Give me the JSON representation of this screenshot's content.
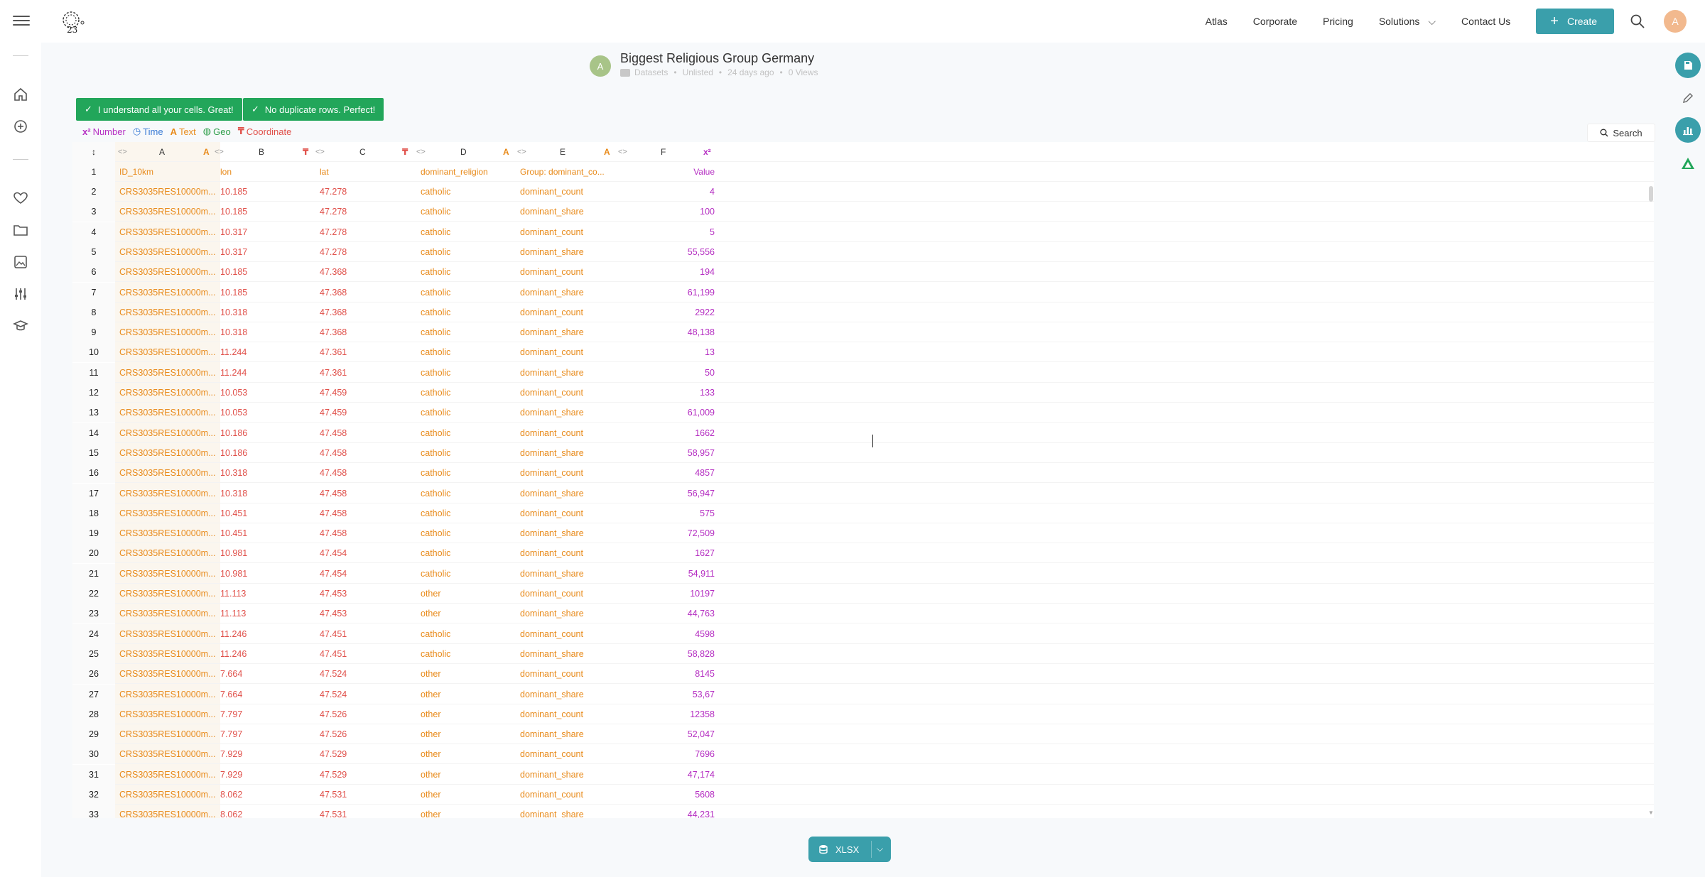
{
  "nav": {
    "links": [
      "Atlas",
      "Corporate",
      "Pricing",
      "Solutions",
      "Contact Us"
    ],
    "create_label": "Create",
    "avatar_initial": "A"
  },
  "dataset": {
    "title": "Biggest Religious Group Germany",
    "avatar_initial": "A",
    "folder": "Datasets",
    "visibility": "Unlisted",
    "age": "24 days ago",
    "views": "0 Views"
  },
  "badges": [
    "I understand all your cells. Great!",
    "No duplicate rows. Perfect!"
  ],
  "legend": {
    "number": "Number",
    "time": "Time",
    "text": "Text",
    "geo": "Geo",
    "coordinate": "Coordinate",
    "number_sym": "x²",
    "text_sym": "A",
    "coord_sym": "₸"
  },
  "search_label": "Search",
  "table": {
    "corner": "↕",
    "letters": [
      "A",
      "B",
      "C",
      "D",
      "E",
      "F"
    ],
    "headers": [
      "ID_10km",
      "lon",
      "lat",
      "dominant_religion",
      "Group: dominant_co...",
      "Value"
    ],
    "rows": [
      [
        "2",
        "CRS3035RES10000m...",
        "10.185",
        "47.278",
        "catholic",
        "dominant_count",
        "4"
      ],
      [
        "3",
        "CRS3035RES10000m...",
        "10.185",
        "47.278",
        "catholic",
        "dominant_share",
        "100"
      ],
      [
        "4",
        "CRS3035RES10000m...",
        "10.317",
        "47.278",
        "catholic",
        "dominant_count",
        "5"
      ],
      [
        "5",
        "CRS3035RES10000m...",
        "10.317",
        "47.278",
        "catholic",
        "dominant_share",
        "55,556"
      ],
      [
        "6",
        "CRS3035RES10000m...",
        "10.185",
        "47.368",
        "catholic",
        "dominant_count",
        "194"
      ],
      [
        "7",
        "CRS3035RES10000m...",
        "10.185",
        "47.368",
        "catholic",
        "dominant_share",
        "61,199"
      ],
      [
        "8",
        "CRS3035RES10000m...",
        "10.318",
        "47.368",
        "catholic",
        "dominant_count",
        "2922"
      ],
      [
        "9",
        "CRS3035RES10000m...",
        "10.318",
        "47.368",
        "catholic",
        "dominant_share",
        "48,138"
      ],
      [
        "10",
        "CRS3035RES10000m...",
        "11.244",
        "47.361",
        "catholic",
        "dominant_count",
        "13"
      ],
      [
        "11",
        "CRS3035RES10000m...",
        "11.244",
        "47.361",
        "catholic",
        "dominant_share",
        "50"
      ],
      [
        "12",
        "CRS3035RES10000m...",
        "10.053",
        "47.459",
        "catholic",
        "dominant_count",
        "133"
      ],
      [
        "13",
        "CRS3035RES10000m...",
        "10.053",
        "47.459",
        "catholic",
        "dominant_share",
        "61,009"
      ],
      [
        "14",
        "CRS3035RES10000m...",
        "10.186",
        "47.458",
        "catholic",
        "dominant_count",
        "1662"
      ],
      [
        "15",
        "CRS3035RES10000m...",
        "10.186",
        "47.458",
        "catholic",
        "dominant_share",
        "58,957"
      ],
      [
        "16",
        "CRS3035RES10000m...",
        "10.318",
        "47.458",
        "catholic",
        "dominant_count",
        "4857"
      ],
      [
        "17",
        "CRS3035RES10000m...",
        "10.318",
        "47.458",
        "catholic",
        "dominant_share",
        "56,947"
      ],
      [
        "18",
        "CRS3035RES10000m...",
        "10.451",
        "47.458",
        "catholic",
        "dominant_count",
        "575"
      ],
      [
        "19",
        "CRS3035RES10000m...",
        "10.451",
        "47.458",
        "catholic",
        "dominant_share",
        "72,509"
      ],
      [
        "20",
        "CRS3035RES10000m...",
        "10.981",
        "47.454",
        "catholic",
        "dominant_count",
        "1627"
      ],
      [
        "21",
        "CRS3035RES10000m...",
        "10.981",
        "47.454",
        "catholic",
        "dominant_share",
        "54,911"
      ],
      [
        "22",
        "CRS3035RES10000m...",
        "11.113",
        "47.453",
        "other",
        "dominant_count",
        "10197"
      ],
      [
        "23",
        "CRS3035RES10000m...",
        "11.113",
        "47.453",
        "other",
        "dominant_share",
        "44,763"
      ],
      [
        "24",
        "CRS3035RES10000m...",
        "11.246",
        "47.451",
        "catholic",
        "dominant_count",
        "4598"
      ],
      [
        "25",
        "CRS3035RES10000m...",
        "11.246",
        "47.451",
        "catholic",
        "dominant_share",
        "58,828"
      ],
      [
        "26",
        "CRS3035RES10000m...",
        "7.664",
        "47.524",
        "other",
        "dominant_count",
        "8145"
      ],
      [
        "27",
        "CRS3035RES10000m...",
        "7.664",
        "47.524",
        "other",
        "dominant_share",
        "53,67"
      ],
      [
        "28",
        "CRS3035RES10000m...",
        "7.797",
        "47.526",
        "other",
        "dominant_count",
        "12358"
      ],
      [
        "29",
        "CRS3035RES10000m...",
        "7.797",
        "47.526",
        "other",
        "dominant_share",
        "52,047"
      ],
      [
        "30",
        "CRS3035RES10000m...",
        "7.929",
        "47.529",
        "other",
        "dominant_count",
        "7696"
      ],
      [
        "31",
        "CRS3035RES10000m...",
        "7.929",
        "47.529",
        "other",
        "dominant_share",
        "47,174"
      ],
      [
        "32",
        "CRS3035RES10000m...",
        "8.062",
        "47.531",
        "other",
        "dominant_count",
        "5608"
      ],
      [
        "33",
        "CRS3035RES10000m...",
        "8.062",
        "47.531",
        "other",
        "dominant_share",
        "44,231"
      ]
    ]
  },
  "export_label": "XLSX",
  "colors": {
    "accent": "#3a9fab",
    "badge_green": "#22a65a",
    "text_type": "#e88a1a",
    "number_type": "#b52ec2",
    "coordinate_type": "#e0504a",
    "geo_type": "#2e9e4a",
    "time_type": "#3a7bd5"
  }
}
